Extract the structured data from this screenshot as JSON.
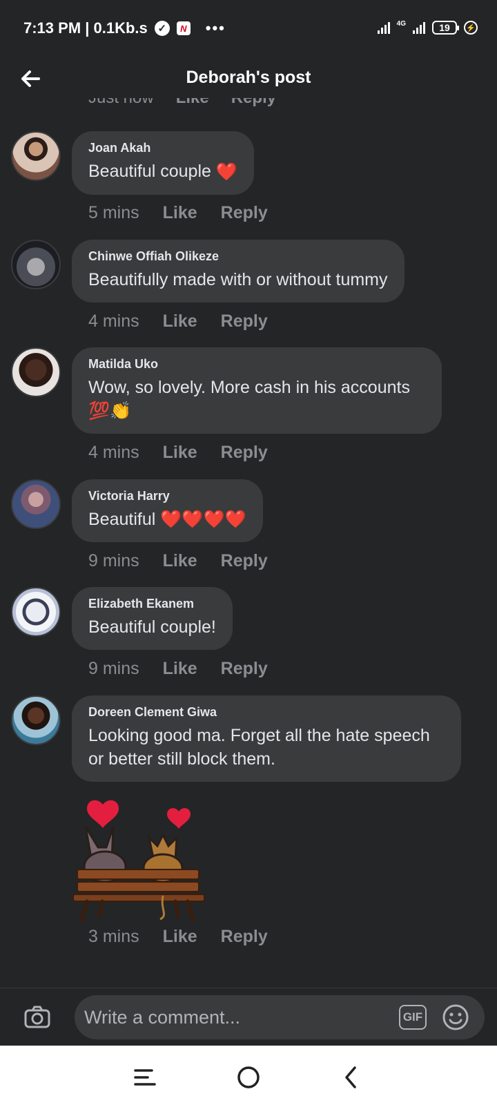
{
  "status_bar": {
    "time_speed": "7:13 PM | 0.1Kb.s",
    "network_label": "4G",
    "battery": "19"
  },
  "header": {
    "title": "Deborah's post"
  },
  "previous_comment_meta": {
    "time": "Just now",
    "like": "Like",
    "reply": "Reply"
  },
  "comments": [
    {
      "name": "Joan Akah",
      "text": "Beautiful couple",
      "emoji": "❤️",
      "time": "5 mins",
      "like": "Like",
      "reply": "Reply"
    },
    {
      "name": "Chinwe Offiah Olikeze",
      "text": "Beautifully made with or without tummy",
      "time": "4 mins",
      "like": "Like",
      "reply": "Reply"
    },
    {
      "name": "Matilda Uko",
      "text": "Wow, so lovely. More cash in his accounts",
      "emoji": "💯👏",
      "time": "4 mins",
      "like": "Like",
      "reply": "Reply"
    },
    {
      "name": "Victoria Harry",
      "text": "Beautiful",
      "emoji": "❤️❤️❤️❤️",
      "time": "9 mins",
      "like": "Like",
      "reply": "Reply"
    },
    {
      "name": "Elizabeth Ekanem",
      "text": "Beautiful couple!",
      "time": "9 mins",
      "like": "Like",
      "reply": "Reply"
    },
    {
      "name": "Doreen Clement Giwa",
      "text": "Looking good ma. Forget all the hate speech or better still block them.",
      "time": "3 mins",
      "like": "Like",
      "reply": "Reply",
      "has_sticker": true
    }
  ],
  "composer": {
    "placeholder": "Write a comment...",
    "gif_label": "GIF"
  },
  "colors": {
    "background": "#242526",
    "bubble": "#3a3b3c",
    "meta_text": "#8a8d91",
    "heart": "#e41e3f"
  }
}
